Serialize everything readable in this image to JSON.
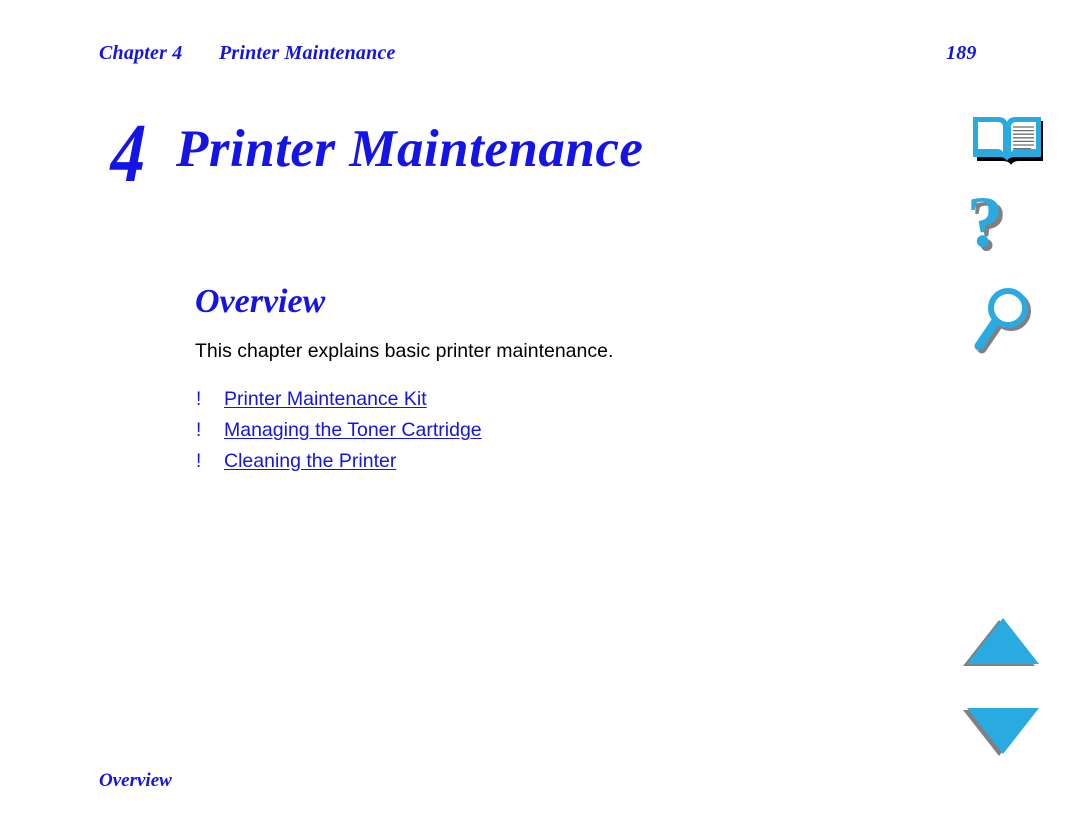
{
  "colors": {
    "heading_blue": "#1414E6",
    "link_blue": "#1414E6",
    "icon_cyan": "#29ABE2",
    "icon_shadow_gray": "#808080",
    "icon_shadow_black": "#000000",
    "body_text": "#000000",
    "page_background": "#FFFFFF"
  },
  "header": {
    "chapter_label": "Chapter 4",
    "document_title": "Printer Maintenance",
    "page_number": "189"
  },
  "chapter": {
    "number": "4",
    "title": "Printer Maintenance"
  },
  "section": {
    "heading": "Overview",
    "intro": "This chapter explains basic printer maintenance.",
    "links": [
      {
        "bullet": "!",
        "label": "Printer Maintenance Kit"
      },
      {
        "bullet": "!",
        "label": "Managing the Toner Cartridge"
      },
      {
        "bullet": "!",
        "label": "Cleaning the Printer"
      }
    ]
  },
  "footer": {
    "section_name": "Overview"
  },
  "nav_icons": [
    {
      "name": "book-icon",
      "tooltip": "Contents"
    },
    {
      "name": "question-mark-icon",
      "tooltip": "Help"
    },
    {
      "name": "magnifier-icon",
      "tooltip": "Search"
    },
    {
      "name": "triangle-up-icon",
      "tooltip": "Previous page"
    },
    {
      "name": "triangle-down-icon",
      "tooltip": "Next page"
    }
  ]
}
